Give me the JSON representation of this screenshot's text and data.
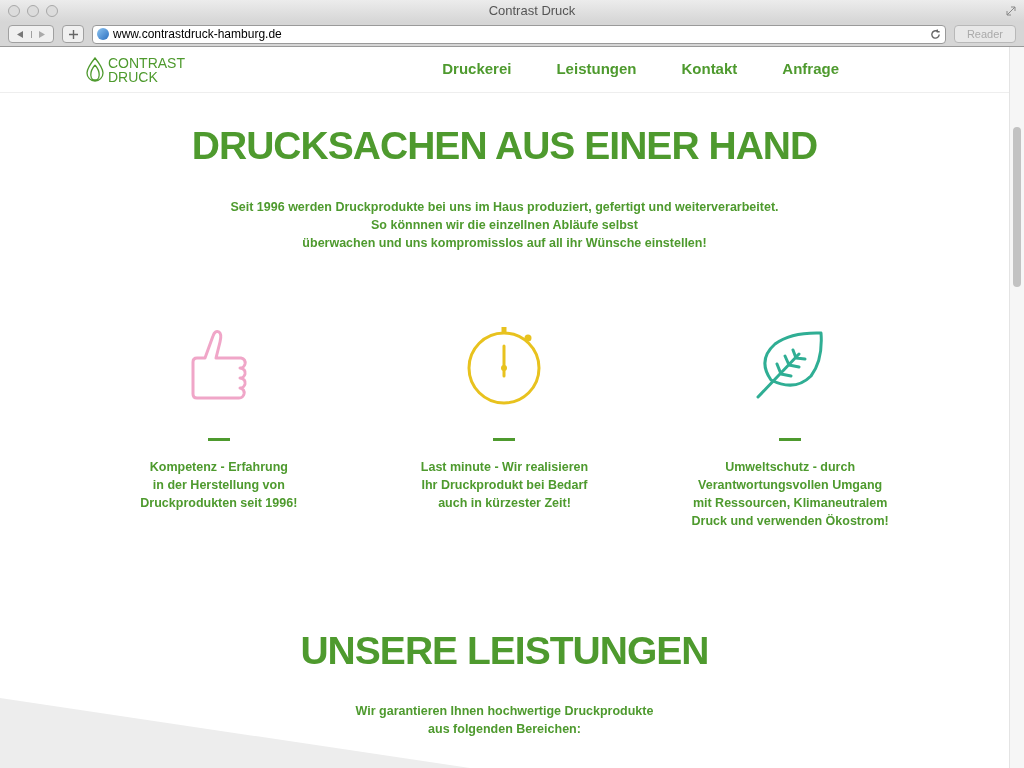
{
  "window": {
    "title": "Contrast Druck"
  },
  "toolbar": {
    "url": "www.contrastdruck-hamburg.de",
    "reader": "Reader"
  },
  "logo": {
    "line1": "CONTRAST",
    "line2": "DRUCK"
  },
  "nav": [
    {
      "label": "Druckerei"
    },
    {
      "label": "Leistungen"
    },
    {
      "label": "Kontakt"
    },
    {
      "label": "Anfrage"
    }
  ],
  "hero": {
    "title": "DRUCKSACHEN AUS EINER HAND",
    "text": "Seit 1996 werden Druckprodukte bei uns im Haus produziert, gefertigt und weiterverarbeitet.\nSo könnnen wir die einzellnen Abläufe selbst\nüberwachen und uns kompromisslos auf all ihr Wünsche einstellen!"
  },
  "features": [
    {
      "kind": "thumb",
      "color": "#f0a6c8",
      "text": "Kompetenz - Erfahrung\nin der Herstellung von\nDruckprodukten seit 1996!"
    },
    {
      "kind": "stopwatch",
      "color": "#e8c21e",
      "text": "Last minute - Wir realisieren\nIhr Druckprodukt bei Bedarf\nauch in kürzester Zeit!"
    },
    {
      "kind": "leaf",
      "color": "#2fae94",
      "text": "Umweltschutz - durch\nVerantwortungsvollen Umgang\nmit Ressourcen, Klimaneutralem\nDruck und verwenden Ökostrom!"
    }
  ],
  "services": {
    "title": "UNSERE LEISTUNGEN",
    "text": "Wir garantieren Ihnen hochwertige Druckprodukte\naus folgenden Bereichen:"
  }
}
